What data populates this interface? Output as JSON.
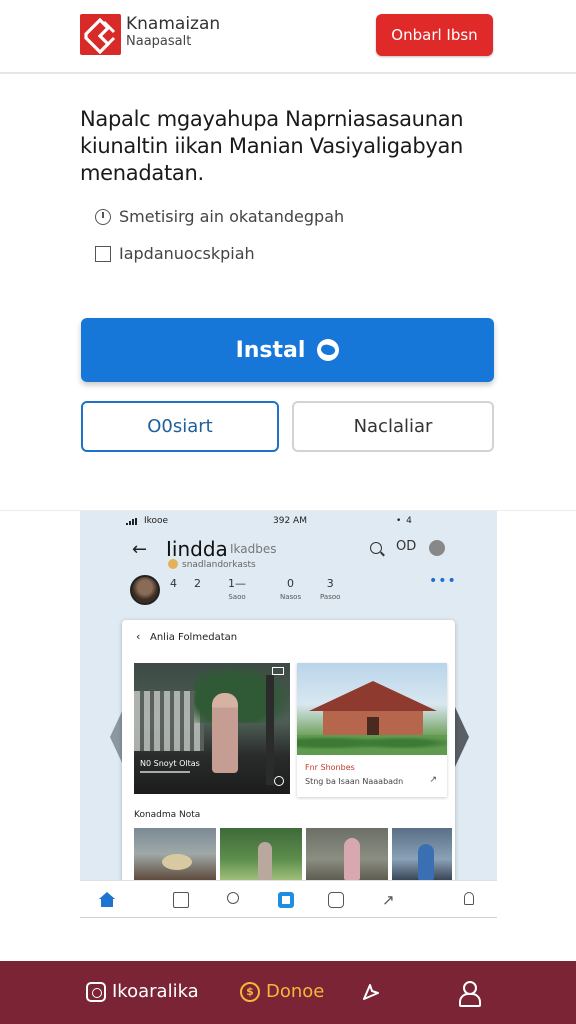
{
  "header": {
    "logo_line1": "Knamaizan",
    "logo_line2": "Naapasalt",
    "cta_label": "Onbarl Ibsn"
  },
  "main": {
    "headline": "Napalc mgayahupa Naprniasasaunan kiunaltin iikan Manian Vasiyaligabyan menadatan.",
    "options": [
      {
        "label": "Smetisirg ain okatandegpah",
        "icon": "clock-icon"
      },
      {
        "label": "Iapdanuocskpiah",
        "icon": "checkbox-icon"
      }
    ],
    "install_label": "Instal",
    "secondary_left_label": "O0siart",
    "secondary_right_label": "Naclaliar"
  },
  "preview": {
    "status_left": "Ikooe",
    "status_time": "392 AM",
    "status_right": "• 4",
    "app_title": "Iindda",
    "app_subtitle": "Ikadbes",
    "app_account": "snadlandorkasts",
    "icon_label_cd": "OD",
    "stats": [
      {
        "value": "4",
        "label": ""
      },
      {
        "value": "2",
        "label": ""
      },
      {
        "value": "1—",
        "label": "Saoo"
      },
      {
        "value": "0",
        "label": "Nasos"
      },
      {
        "value": "3",
        "label": "Pasoo"
      }
    ],
    "more_label": "•••",
    "card_title": "Anlia Folmedatan",
    "photo1_caption": "N0 Snoyt Oltas",
    "photo2_caption": "Fnr Shonbes",
    "photo2_subcaption": "Stng ba Isaan Naaabadn",
    "section_label": "Konadma Nota"
  },
  "bottom_nav": {
    "instagram_label": "Ikoaralika",
    "donate_label": "Donoe",
    "donate_icon": "coin-icon",
    "share_icon": "share-icon",
    "user_icon": "user-icon"
  },
  "colors": {
    "brand_red": "#e02a2a",
    "primary_blue": "#1677d8",
    "bottom_nav_bg": "#7b2435",
    "donate_accent": "#f3b73b"
  }
}
